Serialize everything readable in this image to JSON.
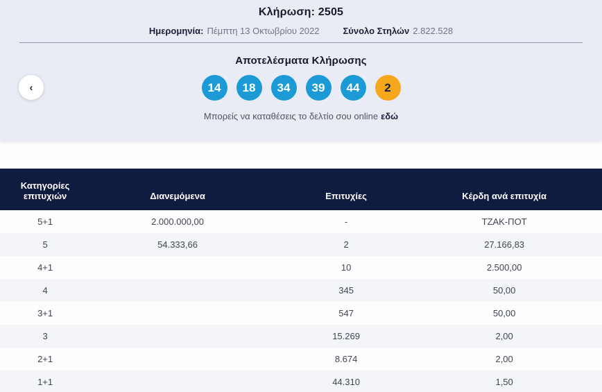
{
  "colors": {
    "navy": "#101c3f",
    "accent_blue": "#1b9ad6",
    "bonus_orange": "#f7a71c",
    "panel_bg": "#e9ecf4"
  },
  "draw": {
    "title": "Κλήρωση: 2505",
    "date_label": "Ημερομηνία:",
    "date_value": "Πέμπτη 13 Οκτωβρίου 2022",
    "columns_label": "Σύνολο Στηλών",
    "columns_value": "2.822.528"
  },
  "results": {
    "heading": "Αποτελέσματα Κλήρωσης",
    "numbers": [
      {
        "value": "14",
        "type": "main"
      },
      {
        "value": "18",
        "type": "main"
      },
      {
        "value": "34",
        "type": "main"
      },
      {
        "value": "39",
        "type": "main"
      },
      {
        "value": "44",
        "type": "main"
      },
      {
        "value": "2",
        "type": "bonus"
      }
    ],
    "prev_icon_glyph": "‹",
    "footnote_text": "Μπορείς να καταθέσεις το δελτίο σου online",
    "footnote_link": "εδώ"
  },
  "table": {
    "headers": [
      "Κατηγορίες επιτυχιών",
      "Διανεμόμενα",
      "Επιτυχίες",
      "Κέρδη ανά επιτυχία"
    ],
    "rows": [
      {
        "category": "5+1",
        "distributed": "2.000.000,00",
        "winners": "-",
        "prize": "ΤΖΑΚ-ΠΟΤ"
      },
      {
        "category": "5",
        "distributed": "54.333,66",
        "winners": "2",
        "prize": "27.166,83"
      },
      {
        "category": "4+1",
        "distributed": "",
        "winners": "10",
        "prize": "2.500,00"
      },
      {
        "category": "4",
        "distributed": "",
        "winners": "345",
        "prize": "50,00"
      },
      {
        "category": "3+1",
        "distributed": "",
        "winners": "547",
        "prize": "50,00"
      },
      {
        "category": "3",
        "distributed": "",
        "winners": "15.269",
        "prize": "2,00"
      },
      {
        "category": "2+1",
        "distributed": "",
        "winners": "8.674",
        "prize": "2,00"
      },
      {
        "category": "1+1",
        "distributed": "",
        "winners": "44.310",
        "prize": "1,50"
      }
    ]
  }
}
